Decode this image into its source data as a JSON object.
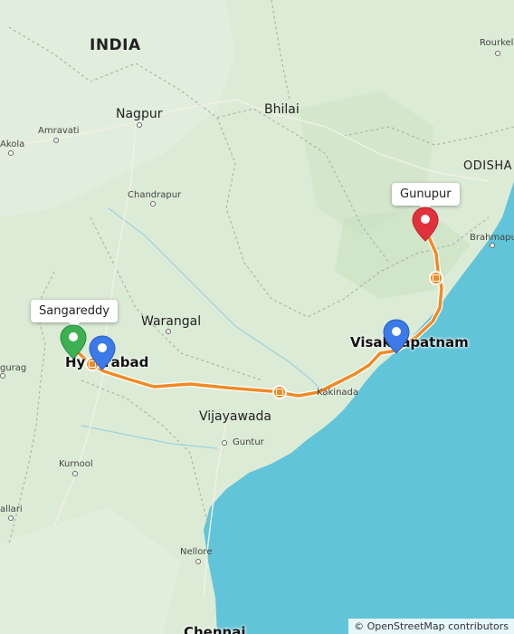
{
  "map": {
    "labels": {
      "country": "INDIA",
      "state_odisha": "ODISHA",
      "nagpur": "Nagpur",
      "bhilai": "Bhilai",
      "rourkela": "Rourkela",
      "amravati": "Amravati",
      "akola": "Akola",
      "chandrapur": "Chandrapur",
      "brahmapur": "Brahmapur",
      "warangal": "Warangal",
      "hyderabad": "Hyderabad",
      "visakhapatnam": "Visakhapatnam",
      "kakinada": "Kakinada",
      "vijayawada": "Vijayawada",
      "guntur": "Guntur",
      "kurnool": "Kurnool",
      "nellore": "Nellore",
      "chennai": "Chennai",
      "gurag": "gurag",
      "ballari": "allari"
    },
    "callouts": {
      "sangareddy": "Sangareddy",
      "gunupur": "Gunupur"
    },
    "markers": {
      "start_color": "#3db054",
      "waypoint_color": "#3b7ae8",
      "end_color": "#e1323b"
    },
    "route_color": "#f08a24",
    "attribution": "© OpenStreetMap contributors"
  }
}
